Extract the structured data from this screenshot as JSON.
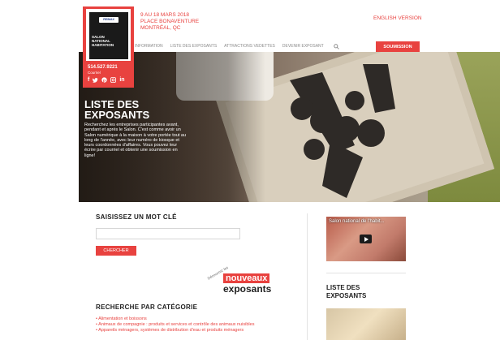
{
  "header": {
    "event_date": "9 AU 18 MARS 2018",
    "event_place": "PLACE BONAVENTURE",
    "event_city": "MONTRÉAL, QC",
    "lang_link": "ENGLISH VERSION",
    "nav": [
      {
        "label": "INFORMATION"
      },
      {
        "label": "LISTE DES EXPOSANTS"
      },
      {
        "label": "ATTRACTIONS VEDETTES"
      },
      {
        "label": "DEVENIR EXPOSANT"
      }
    ],
    "cta_label": "SOUMISSION"
  },
  "logo": {
    "brand": "RE/MAX",
    "name_line1": "SALON",
    "name_line2": "NATIONAL",
    "name_line3": "HABITATION",
    "phone": "514.527.9221",
    "phone_label": "Courriel",
    "social": [
      "f",
      "t",
      "p",
      "i",
      "in"
    ]
  },
  "hero": {
    "title_line1": "LISTE DES",
    "title_line2": "EXPOSANTS",
    "description": "Recherchez les entreprises participantes avant, pendant et après le Salon. C'est comme avoir un Salon numérique à la maison à votre portée tout au long de l'année, avec leur numéro de kiosque et leurs coordonnées d'affaires. Vous pouvez leur écrire par courriel et obtenir une soumission en ligne!"
  },
  "search": {
    "title": "SAISISSEZ UN MOT CLÉ",
    "placeholder": "",
    "button": "CHERCHER"
  },
  "new_badge": {
    "small": "Découvrez les",
    "main": "nouveaux",
    "sub": "exposants"
  },
  "categories": {
    "title": "RECHERCHE PAR CATÉGORIE",
    "items": [
      "Alimentation et boissons",
      "Animaux de compagnie : produits et services et contrôle des animaux nuisibles",
      "Appareils ménagers, systèmes de distribution d'eau et produits ménagers"
    ]
  },
  "sidebar": {
    "video_title": "Salon national de l'habit...",
    "section_title_line1": "LISTE DES",
    "section_title_line2": "EXPOSANTS"
  },
  "colors": {
    "accent": "#e8423f"
  }
}
